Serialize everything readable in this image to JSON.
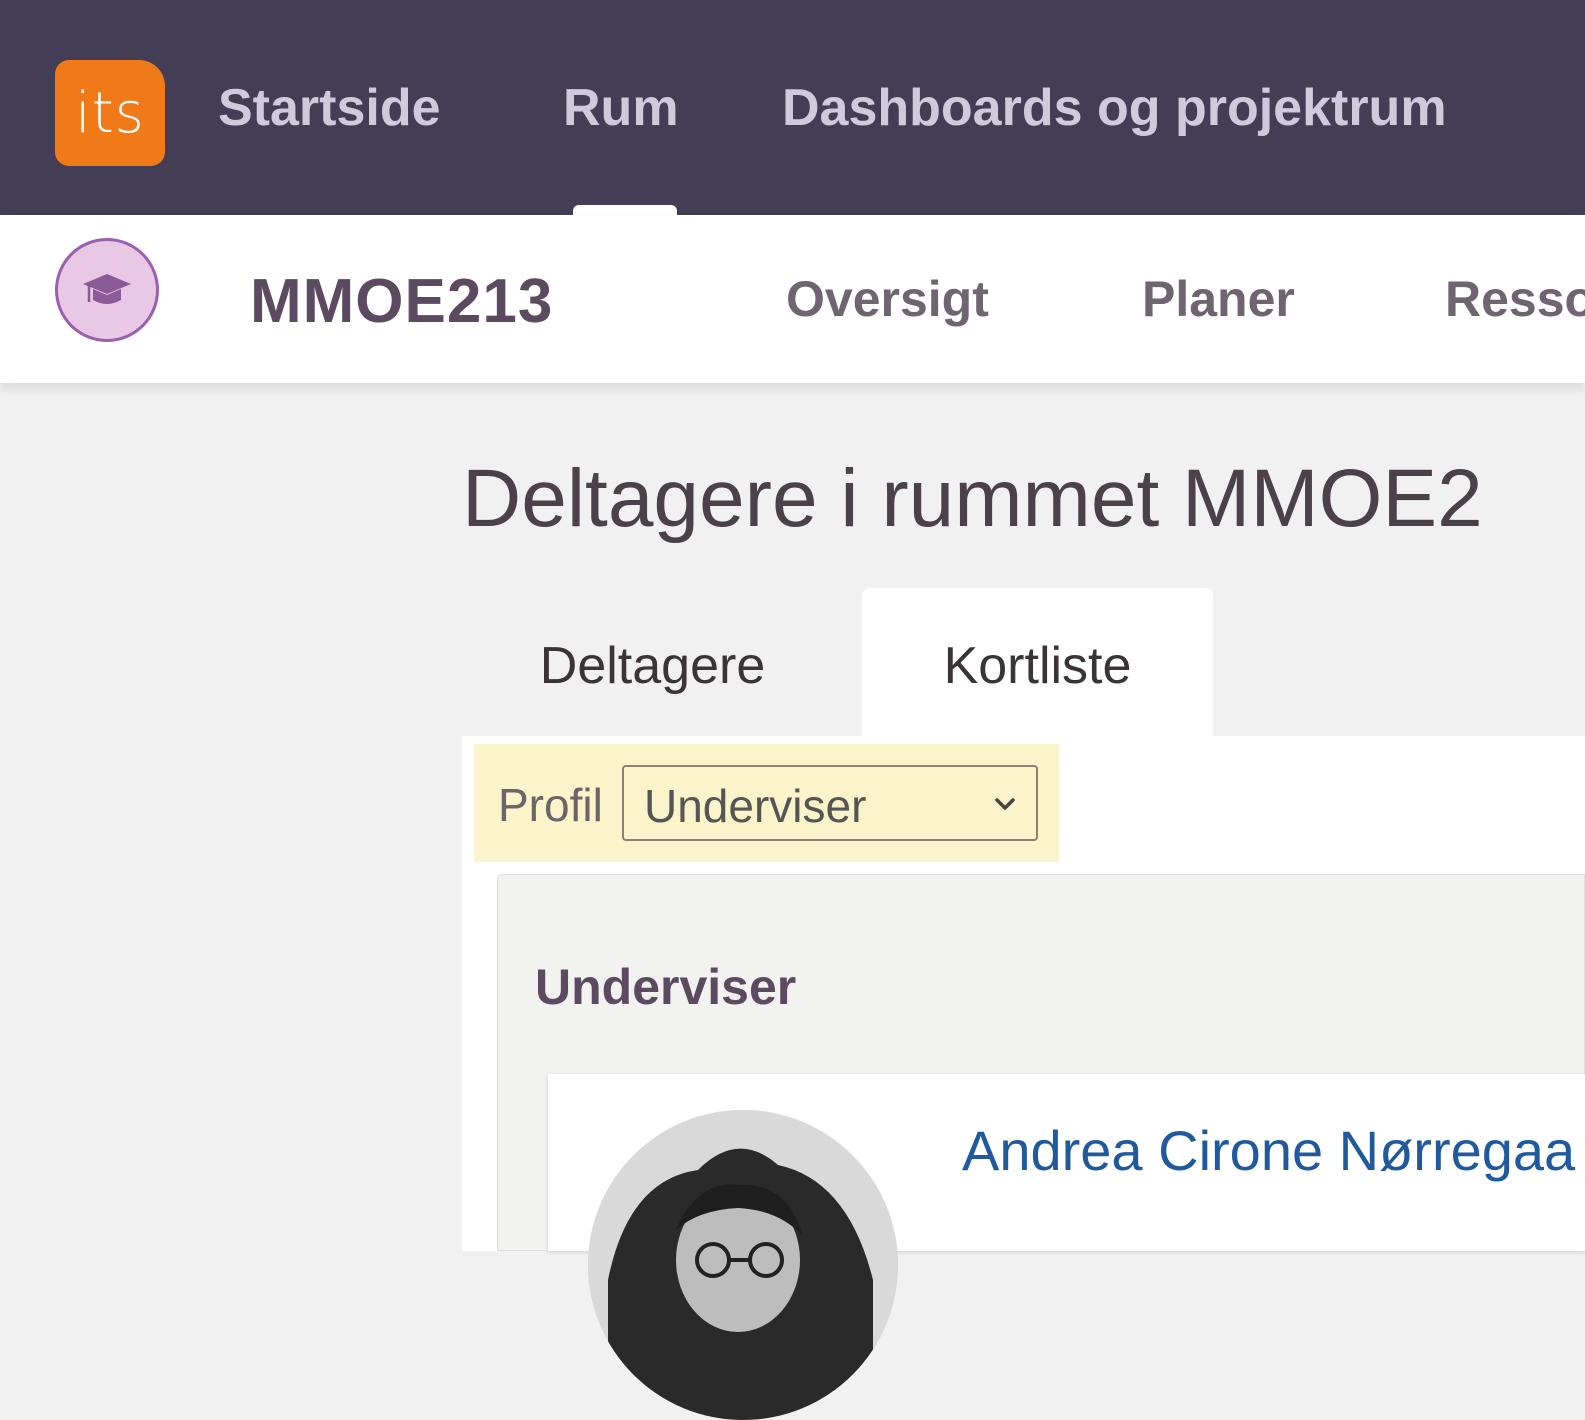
{
  "topnav": {
    "logo_text": "its",
    "items": [
      {
        "label": "Startside"
      },
      {
        "label": "Rum"
      },
      {
        "label": "Dashboards og projektrum"
      }
    ],
    "active_item": "Rum"
  },
  "room": {
    "icon": "graduation-cap-icon",
    "title": "MMOE213",
    "subnav": [
      {
        "label": "Oversigt"
      },
      {
        "label": "Planer"
      },
      {
        "label": "Resso"
      }
    ]
  },
  "page": {
    "title": "Deltagere i rummet MMOE2",
    "tabs": [
      {
        "label": "Deltagere"
      },
      {
        "label": "Kortliste"
      }
    ],
    "active_tab": "Kortliste"
  },
  "filter": {
    "label": "Profil",
    "selected": "Underviser"
  },
  "section": {
    "heading": "Underviser",
    "person_name": "Andrea Cirone Nørregaa"
  },
  "colors": {
    "topnav_bg": "#433d56",
    "logo_orange": "#ef7a17",
    "filter_highlight": "#fbf3c9",
    "link_blue": "#1f5a9e"
  }
}
